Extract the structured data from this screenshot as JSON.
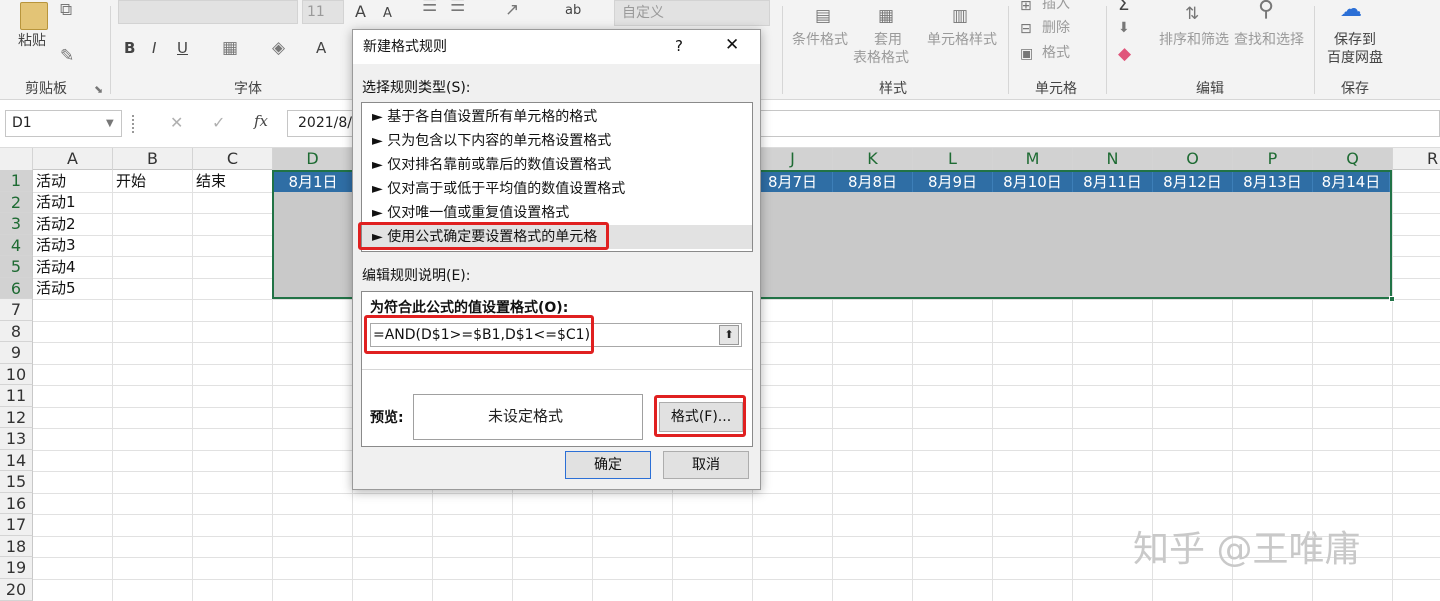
{
  "ribbon": {
    "clipboard": {
      "paste": "粘贴",
      "label": "剪贴板"
    },
    "font": {
      "size": "11",
      "label": "字体",
      "bold": "B",
      "italic": "I",
      "underline": "U",
      "grow": "A",
      "shrink": "A"
    },
    "alignment": {
      "wrap": "ab"
    },
    "number": {
      "format": "自定义"
    },
    "styles": {
      "conditional": "条件格式",
      "table_line1": "套用",
      "table_line2": "表格格式",
      "cell_styles": "单元格样式",
      "label": "样式"
    },
    "cells": {
      "insert": "插入",
      "delete": "删除",
      "format": "格式",
      "label": "单元格"
    },
    "editing": {
      "sum": "Σ",
      "sort": "排序和筛选",
      "find": "查找和选择",
      "label": "编辑"
    },
    "save": {
      "line1": "保存到",
      "line2": "百度网盘",
      "label": "保存"
    }
  },
  "formula_bar": {
    "name_box": "D1",
    "cancel": "✕",
    "confirm": "✓",
    "fx": "fx",
    "value": "2021/8/"
  },
  "columns": [
    "A",
    "B",
    "C",
    "D",
    "J",
    "K",
    "L",
    "M",
    "N",
    "O",
    "P",
    "Q",
    "R"
  ],
  "rows": [
    "1",
    "2",
    "3",
    "4",
    "5",
    "6",
    "7",
    "8",
    "9",
    "10",
    "11",
    "12",
    "13",
    "14",
    "15",
    "16",
    "17",
    "18",
    "19",
    "20"
  ],
  "cells": {
    "a1": "活动",
    "b1": "开始",
    "c1": "结束",
    "a2": "活动1",
    "a3": "活动2",
    "a4": "活动3",
    "a5": "活动4",
    "a6": "活动5"
  },
  "dates": {
    "d1": "8月1日",
    "j1": "8月7日",
    "k1": "8月8日",
    "l1": "8月9日",
    "m1": "8月10日",
    "n1": "8月11日",
    "o1": "8月12日",
    "p1": "8月13日",
    "q1": "8月14日"
  },
  "dialog": {
    "title": "新建格式规则",
    "help": "?",
    "close": "✕",
    "select_type_label": "选择规则类型(S):",
    "rule_types": [
      "► 基于各自值设置所有单元格的格式",
      "► 只为包含以下内容的单元格设置格式",
      "► 仅对排名靠前或靠后的数值设置格式",
      "► 仅对高于或低于平均值的数值设置格式",
      "► 仅对唯一值或重复值设置格式",
      "► 使用公式确定要设置格式的单元格"
    ],
    "edit_desc_label": "编辑规则说明(E):",
    "formula_label": "为符合此公式的值设置格式(O):",
    "formula_value": "=AND(D$1>=$B1,D$1<=$C1)",
    "preview_label": "预览:",
    "preview_text": "未设定格式",
    "format_button": "格式(F)...",
    "ok_button": "确定",
    "cancel_button": "取消"
  },
  "watermark": "知乎 @王唯庸"
}
